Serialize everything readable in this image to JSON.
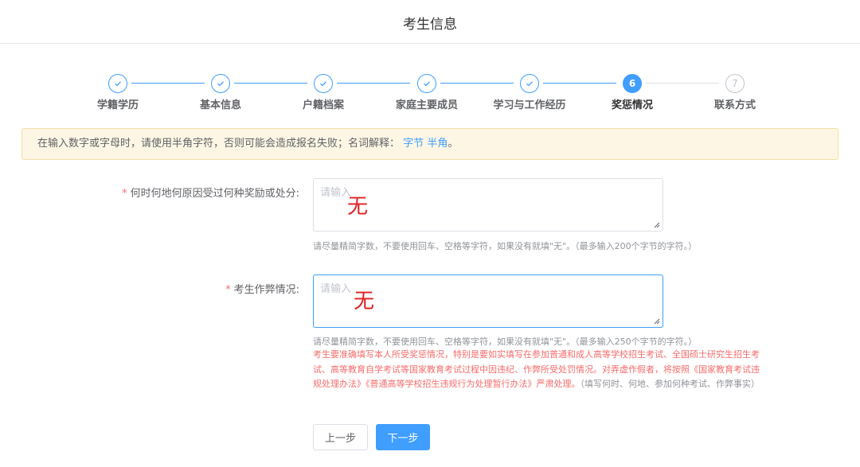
{
  "header": {
    "title": "考生信息"
  },
  "steps": [
    {
      "label": "学籍学历",
      "state": "done",
      "icon": "check-icon"
    },
    {
      "label": "基本信息",
      "state": "done",
      "icon": "check-icon"
    },
    {
      "label": "户籍档案",
      "state": "done",
      "icon": "check-icon"
    },
    {
      "label": "家庭主要成员",
      "state": "done",
      "icon": "check-icon"
    },
    {
      "label": "学习与工作经历",
      "state": "done",
      "icon": "check-icon"
    },
    {
      "label": "奖惩情况",
      "state": "active",
      "number": "6"
    },
    {
      "label": "联系方式",
      "state": "wait",
      "number": "7"
    }
  ],
  "alert": {
    "text": "在输入数字或字母时，请使用半角字符，否则可能会造成报名失败；名词解释：",
    "link1": "字节",
    "link2": "半角",
    "tail": "。"
  },
  "form": {
    "field1": {
      "required_mark": "*",
      "label": "何时何地何原因受过何种奖励或处分:",
      "placeholder": "请输入",
      "handwritten_value": "无",
      "hint": "请尽量精简字数，不要使用回车、空格等字符，如果没有就填\"无\"。（最多输入200个字节的字符。）"
    },
    "field2": {
      "required_mark": "*",
      "label": "考生作弊情况:",
      "placeholder": "请输入",
      "handwritten_value": "无",
      "hint": "请尽量精简字数，不要使用回车、空格等字符，如果没有就填\"无\"。（最多输入250个字节的字符。）",
      "warning": "考生要准确填写本人所受奖惩情况，特别是要如实填写在参加普通和成人高等学校招生考试、全国硕士研究生招生考试、高等教育自学考试等国家教育考试过程中因违纪、作弊所受处罚情况。对弄虚作假者，将按照《国家教育考试违规处理办法》《普通高等学校招生违规行为处理暂行办法》严肃处理。",
      "warning_note": "（填写何时、何地、参加何种考试、作弊事实）"
    }
  },
  "buttons": {
    "prev": "上一步",
    "next": "下一步"
  },
  "colors": {
    "primary": "#409eff",
    "warning_bg": "#fdf6e4",
    "danger": "#f56c6c",
    "handwriting": "#e02020"
  }
}
